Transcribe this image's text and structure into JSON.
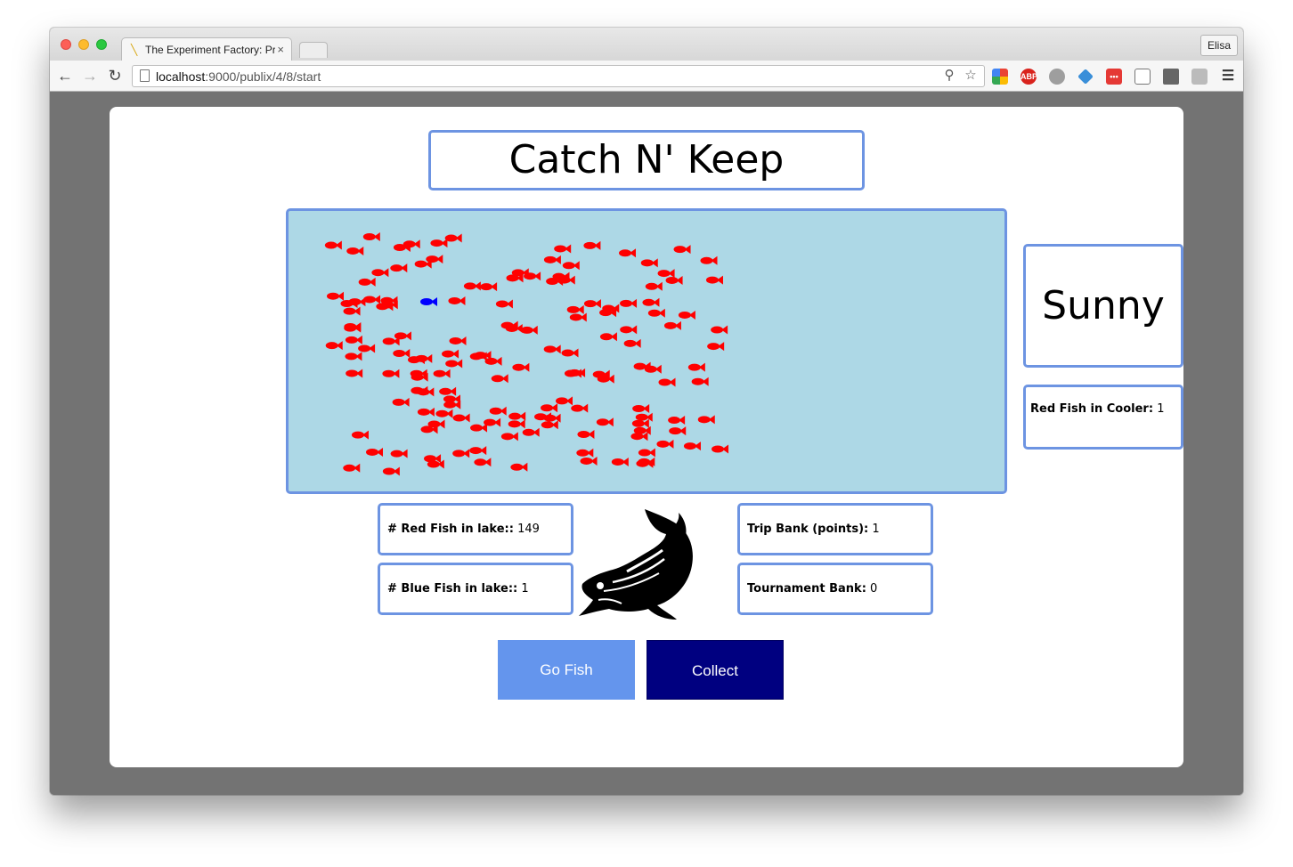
{
  "browser": {
    "profile_name": "Elisa",
    "tab_title": "The Experiment Factory: Pr",
    "url_host": "localhost",
    "url_path": ":9000/publix/4/8/start"
  },
  "game": {
    "title": "Catch N' Keep",
    "weather": "Sunny",
    "cooler": {
      "label": "Red Fish in Cooler:",
      "value": "1"
    },
    "red_fish_lake": {
      "label": "# Red Fish in lake::",
      "value": "149"
    },
    "blue_fish_lake": {
      "label": "# Blue Fish in lake::",
      "value": "1"
    },
    "trip_bank": {
      "label": "Trip Bank (points):",
      "value": "1"
    },
    "tournament_bank": {
      "label": "Tournament Bank:",
      "value": "0"
    },
    "buttons": {
      "go_fish": "Go Fish",
      "collect": "Collect"
    }
  },
  "colors": {
    "lake": "#add8e6",
    "border": "#6d94e2",
    "red_fish": "#ff0000",
    "blue_fish": "#0000ff",
    "go_fish_button": "#6495ed",
    "collect_button": "#000080"
  },
  "icons": {
    "logo": "fish-silhouette-icon"
  }
}
